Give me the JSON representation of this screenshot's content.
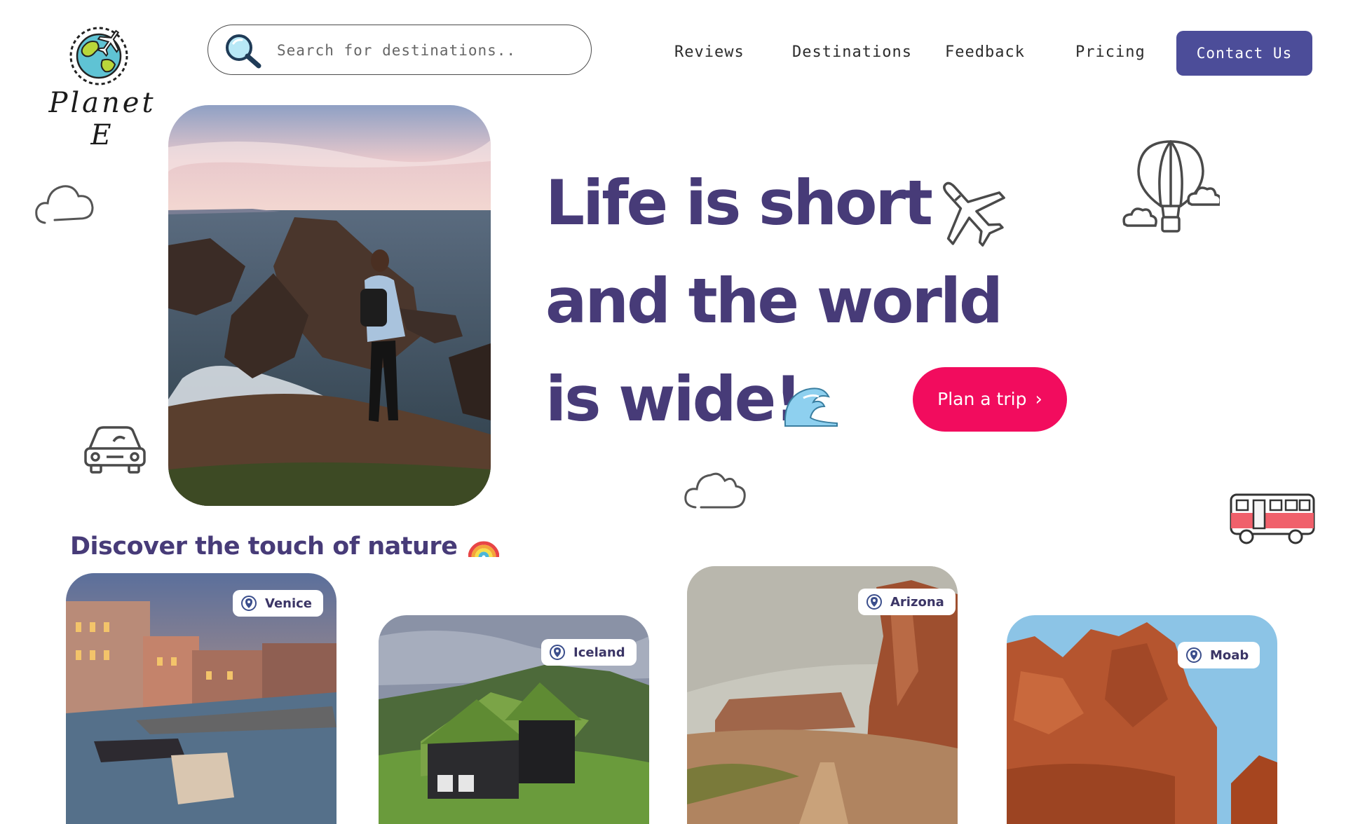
{
  "header": {
    "logo_text": "Planet E",
    "search": {
      "placeholder": "Search for destinations.."
    },
    "nav": [
      {
        "label": "Reviews"
      },
      {
        "label": "Destinations"
      },
      {
        "label": "Feedback"
      },
      {
        "label": "Pricing"
      }
    ],
    "contact_label": "Contact Us"
  },
  "hero": {
    "headline_lines": [
      "Life is short",
      "and the world",
      "is wide!"
    ],
    "cta_label": "Plan a trip"
  },
  "discover": {
    "title": "Discover the touch of nature",
    "cards": [
      {
        "location": "Venice"
      },
      {
        "location": "Iceland"
      },
      {
        "location": "Arizona"
      },
      {
        "location": "Moab"
      }
    ]
  },
  "colors": {
    "brand_purple": "#473b78",
    "button_indigo": "#4c4d99",
    "cta_pink": "#f20c5e"
  },
  "icons": [
    "search-icon",
    "airplane-icon",
    "hot-air-balloon-icon",
    "cloud-icon",
    "car-icon",
    "bus-icon",
    "wave-icon",
    "rainbow-icon",
    "location-pin-icon",
    "chevron-right-icon"
  ]
}
